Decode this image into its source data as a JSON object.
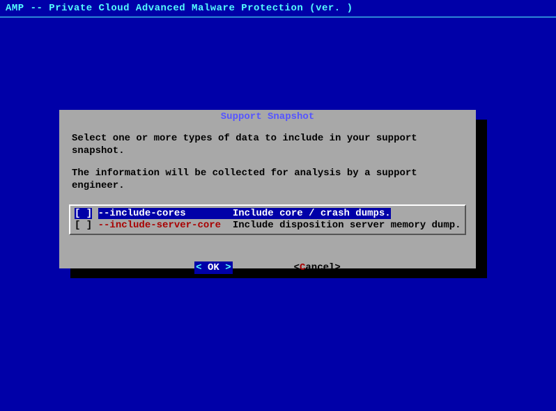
{
  "header": {
    "title": " AMP -- Private Cloud Advanced Malware Protection (ver. )"
  },
  "dialog": {
    "title": "Support Snapshot",
    "line1": "Select one or more types of data to include in your support snapshot.",
    "line2": "The information will be collected for analysis by a support engineer.",
    "options": [
      {
        "checkbox": "[ ]",
        "flag": "--include-cores      ",
        "spacer": "  ",
        "desc": "Include core / crash dumps.",
        "selected": true
      },
      {
        "checkbox": "[ ]",
        "flag": "--include-server-core",
        "spacer": "  ",
        "desc": "Include disposition server memory dump.",
        "selected": false
      }
    ],
    "buttons": {
      "ok": {
        "left_arrow": "<",
        "label": " OK ",
        "right_arrow": ">"
      },
      "cancel": {
        "left": "<",
        "hot": "C",
        "rest": "ancel>",
        "label": "Cancel"
      }
    }
  }
}
